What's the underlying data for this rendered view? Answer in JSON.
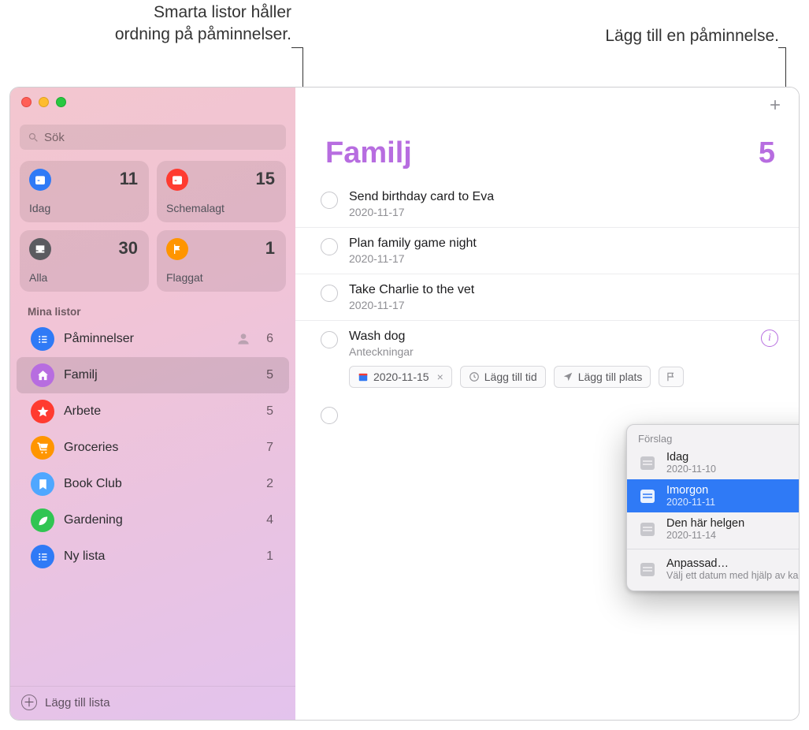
{
  "callouts": {
    "left_line1": "Smarta listor håller",
    "left_line2": "ordning på påminnelser.",
    "right": "Lägg till en påminnelse."
  },
  "search": {
    "placeholder": "Sök"
  },
  "smart": [
    {
      "label": "Idag",
      "count": "11",
      "color": "#2f7af6",
      "icon": "calendar"
    },
    {
      "label": "Schemalagt",
      "count": "15",
      "color": "#ff3b30",
      "icon": "calendar"
    },
    {
      "label": "Alla",
      "count": "30",
      "color": "#5b5b60",
      "icon": "tray"
    },
    {
      "label": "Flaggat",
      "count": "1",
      "color": "#ff9500",
      "icon": "flag"
    }
  ],
  "section_header": "Mina listor",
  "lists": [
    {
      "label": "Påminnelser",
      "count": "6",
      "color": "#2f7af6",
      "icon": "list",
      "shared": true
    },
    {
      "label": "Familj",
      "count": "5",
      "color": "#b76de0",
      "icon": "home",
      "selected": true
    },
    {
      "label": "Arbete",
      "count": "5",
      "color": "#ff3b30",
      "icon": "star"
    },
    {
      "label": "Groceries",
      "count": "7",
      "color": "#ff9500",
      "icon": "cart"
    },
    {
      "label": "Book Club",
      "count": "2",
      "color": "#4fa7ff",
      "icon": "bookmark"
    },
    {
      "label": "Gardening",
      "count": "4",
      "color": "#30c552",
      "icon": "leaf"
    },
    {
      "label": "Ny lista",
      "count": "1",
      "color": "#2f7af6",
      "icon": "list"
    }
  ],
  "footer": {
    "add_list": "Lägg till lista"
  },
  "main": {
    "title": "Familj",
    "count": "5",
    "reminders": [
      {
        "title": "Send birthday card to Eva",
        "sub": "2020-11-17"
      },
      {
        "title": "Plan family game night",
        "sub": "2020-11-17"
      },
      {
        "title": "Take Charlie to the vet",
        "sub": "2020-11-17"
      }
    ],
    "editing": {
      "title": "Wash dog",
      "notes_placeholder": "Anteckningar",
      "date_chip": "2020-11-15",
      "time_chip": "Lägg till tid",
      "place_chip": "Lägg till plats"
    }
  },
  "popover": {
    "header": "Förslag",
    "items": [
      {
        "title": "Idag",
        "sub": "2020-11-10"
      },
      {
        "title": "Imorgon",
        "sub": "2020-11-11",
        "highlight": true
      },
      {
        "title": "Den här helgen",
        "sub": "2020-11-14"
      }
    ],
    "custom": {
      "title": "Anpassad…",
      "sub": "Välj ett datum med hjälp av kalendern"
    }
  }
}
